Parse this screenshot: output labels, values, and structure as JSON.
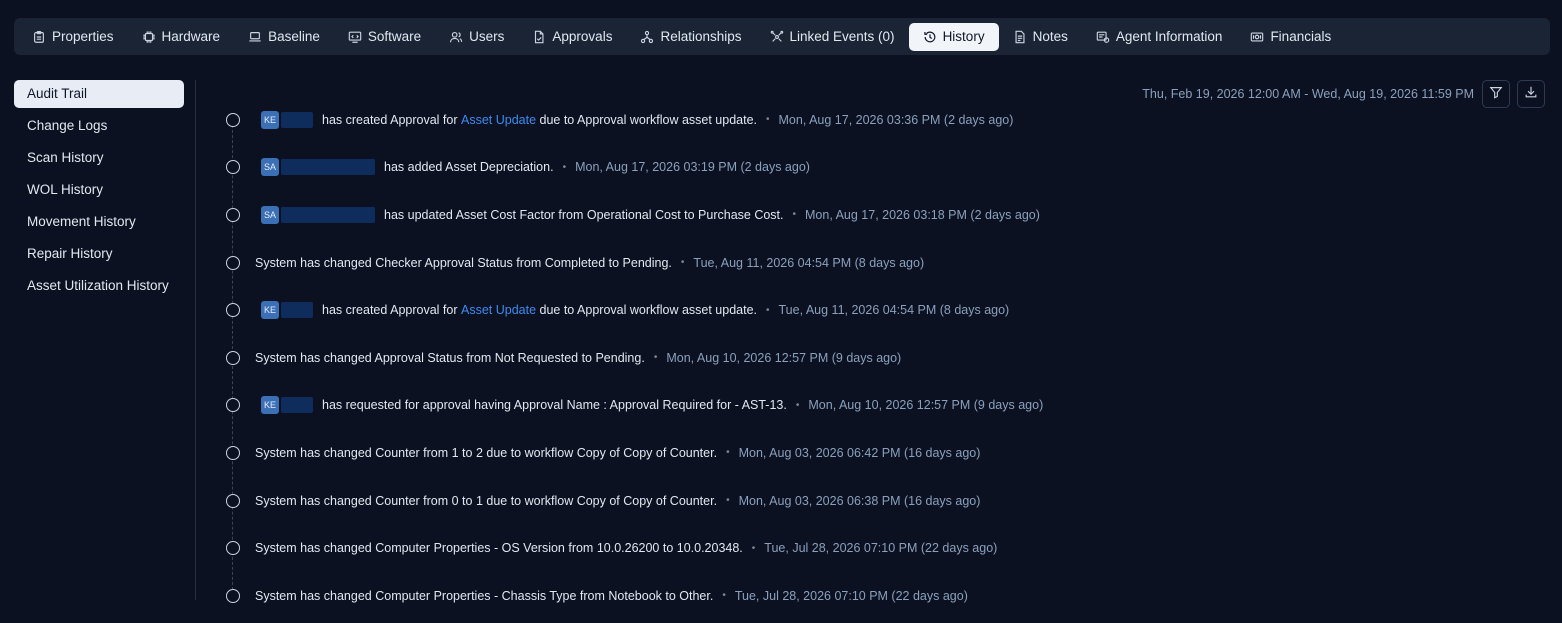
{
  "tabs": [
    {
      "label": "Properties",
      "icon": "clipboard-icon",
      "active": false
    },
    {
      "label": "Hardware",
      "icon": "chip-icon",
      "active": false
    },
    {
      "label": "Baseline",
      "icon": "laptop-icon",
      "active": false
    },
    {
      "label": "Software",
      "icon": "software-icon",
      "active": false
    },
    {
      "label": "Users",
      "icon": "users-icon",
      "active": false
    },
    {
      "label": "Approvals",
      "icon": "file-check-icon",
      "active": false
    },
    {
      "label": "Relationships",
      "icon": "network-icon",
      "active": false
    },
    {
      "label": "Linked Events (0)",
      "icon": "linked-events-icon",
      "active": false
    },
    {
      "label": "History",
      "icon": "history-icon",
      "active": true
    },
    {
      "label": "Notes",
      "icon": "note-icon",
      "active": false
    },
    {
      "label": "Agent Information",
      "icon": "agent-icon",
      "active": false
    },
    {
      "label": "Financials",
      "icon": "money-icon",
      "active": false
    }
  ],
  "sidenav": [
    {
      "label": "Audit Trail",
      "active": true
    },
    {
      "label": "Change Logs",
      "active": false
    },
    {
      "label": "Scan History",
      "active": false
    },
    {
      "label": "WOL History",
      "active": false
    },
    {
      "label": "Movement History",
      "active": false
    },
    {
      "label": "Repair History",
      "active": false
    },
    {
      "label": "Asset Utilization History",
      "active": false
    }
  ],
  "date_range": "Thu, Feb 19, 2026 12:00 AM - Wed, Aug 19, 2026 11:59 PM",
  "toolbar": {
    "filter_icon": "filter-icon",
    "download_icon": "download-icon"
  },
  "entries": [
    {
      "avatar": "KE",
      "pre": "has created Approval for ",
      "link": "Asset Update",
      "post": " due to Approval workflow asset update.",
      "time": "Mon, Aug 17, 2026 03:36 PM (2 days ago)"
    },
    {
      "avatar": "SA",
      "pre": "has added Asset Depreciation.",
      "link": "",
      "post": "",
      "time": "Mon, Aug 17, 2026 03:19 PM (2 days ago)"
    },
    {
      "avatar": "SA",
      "pre": "has updated Asset Cost Factor from Operational Cost to Purchase Cost.",
      "link": "",
      "post": "",
      "time": "Mon, Aug 17, 2026 03:18 PM (2 days ago)"
    },
    {
      "avatar": "",
      "pre": "System has changed Checker Approval Status from Completed to Pending.",
      "link": "",
      "post": "",
      "time": "Tue, Aug 11, 2026 04:54 PM (8 days ago)"
    },
    {
      "avatar": "KE",
      "pre": "has created Approval for ",
      "link": "Asset Update",
      "post": " due to Approval workflow asset update.",
      "time": "Tue, Aug 11, 2026 04:54 PM (8 days ago)"
    },
    {
      "avatar": "",
      "pre": "System has changed Approval Status from Not Requested to Pending.",
      "link": "",
      "post": "",
      "time": "Mon, Aug 10, 2026 12:57 PM (9 days ago)"
    },
    {
      "avatar": "KE",
      "pre": "has requested for approval having Approval Name : Approval Required for - AST-13.",
      "link": "",
      "post": "",
      "time": "Mon, Aug 10, 2026 12:57 PM (9 days ago)"
    },
    {
      "avatar": "",
      "pre": "System has changed Counter from 1 to 2 due to workflow Copy of Copy of Counter.",
      "link": "",
      "post": "",
      "time": "Mon, Aug 03, 2026 06:42 PM (16 days ago)"
    },
    {
      "avatar": "",
      "pre": "System has changed Counter from 0 to 1 due to workflow Copy of Copy of Counter.",
      "link": "",
      "post": "",
      "time": "Mon, Aug 03, 2026 06:38 PM (16 days ago)"
    },
    {
      "avatar": "",
      "pre": "System has changed Computer Properties - OS Version from 10.0.26200 to 10.0.20348.",
      "link": "",
      "post": "",
      "time": "Tue, Jul 28, 2026 07:10 PM (22 days ago)"
    },
    {
      "avatar": "",
      "pre": "System has changed Computer Properties - Chassis Type from Notebook to Other.",
      "link": "",
      "post": "",
      "time": "Tue, Jul 28, 2026 07:10 PM (22 days ago)"
    }
  ]
}
